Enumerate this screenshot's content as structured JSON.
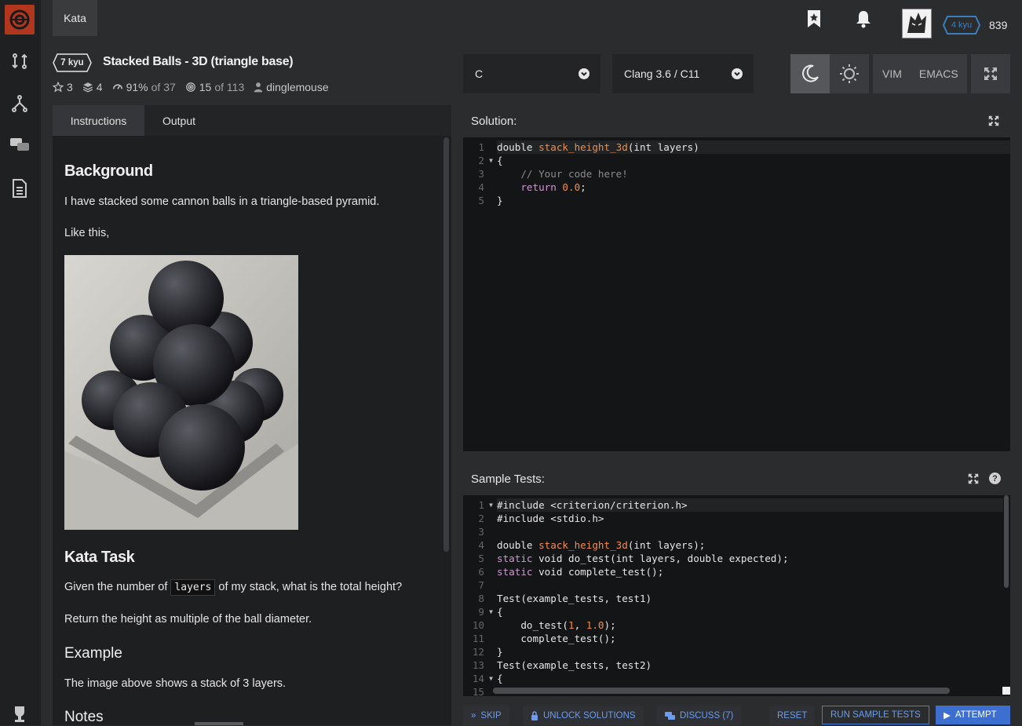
{
  "topbar": {
    "tab": "Kata",
    "honor": "839",
    "rank": "4 kyu"
  },
  "kata": {
    "kyu": "7 kyu",
    "title": "Stacked Balls - 3D (triangle base)",
    "stars": "3",
    "collections": "4",
    "satisfaction": "91%",
    "satisfaction_of": "of 37",
    "completions": "15",
    "completions_of": "of 113",
    "author": "dinglemouse"
  },
  "tabs": [
    "Instructions",
    "Output"
  ],
  "instructions": {
    "h_background": "Background",
    "p1": "I have stacked some cannon balls in a triangle-based pyramid.",
    "p2": "Like this,",
    "h_task": "Kata Task",
    "p3_pre": "Given the number of",
    "p3_code": "layers",
    "p3_post": "of my stack, what is the total height?",
    "p4": "Return the height as multiple of the ball diameter.",
    "h_example": "Example",
    "p5": "The image above shows a stack of 3 layers.",
    "h_notes": "Notes"
  },
  "toolbar": {
    "language": "C",
    "version": "Clang 3.6 / C11",
    "vim": "VIM",
    "emacs": "EMACS"
  },
  "solution": {
    "title": "Solution:",
    "lines": [
      {
        "n": "1",
        "fold": ""
      },
      {
        "n": "2",
        "fold": "▼"
      },
      {
        "n": "3",
        "fold": ""
      },
      {
        "n": "4",
        "fold": ""
      },
      {
        "n": "5",
        "fold": ""
      }
    ],
    "code": {
      "l1a": "double ",
      "l1b": "stack_height_3d",
      "l1c": "(int layers)",
      "l2": "{",
      "l3": "    // Your code here!",
      "l4a": "    return ",
      "l4b": "0.0",
      "l4c": ";",
      "l5": "}"
    }
  },
  "tests": {
    "title": "Sample Tests:",
    "line_numbers": [
      "1",
      "2",
      "3",
      "4",
      "5",
      "6",
      "7",
      "8",
      "9",
      "10",
      "11",
      "12",
      "13",
      "14",
      "15"
    ],
    "code": {
      "l1": "#include <criterion/criterion.h>",
      "l2": "#include <stdio.h>",
      "l4a": "double ",
      "l4b": "stack_height_3d",
      "l4c": "(int layers);",
      "l5a": "static",
      "l5b": " void do_test(int layers, double expected);",
      "l6a": "static",
      "l6b": " void complete_test();",
      "l8": "Test(example_tests, test1)",
      "l9": "{",
      "l10a": "    do_test(",
      "l10b": "1",
      "l10c": ", ",
      "l10d": "1.0",
      "l10e": ");",
      "l11": "    complete_test();",
      "l12": "}",
      "l13": "Test(example_tests, test2)",
      "l14": "{"
    }
  },
  "actions": {
    "skip": "SKIP",
    "unlock": "UNLOCK SOLUTIONS",
    "discuss": "DISCUSS (7)",
    "reset": "RESET",
    "run": "RUN SAMPLE TESTS",
    "attempt": "ATTEMPT"
  },
  "colors": {
    "brand": "#b1361e",
    "accent_blue": "#3d6fd1",
    "rank_blue": "#3c7ebb"
  }
}
